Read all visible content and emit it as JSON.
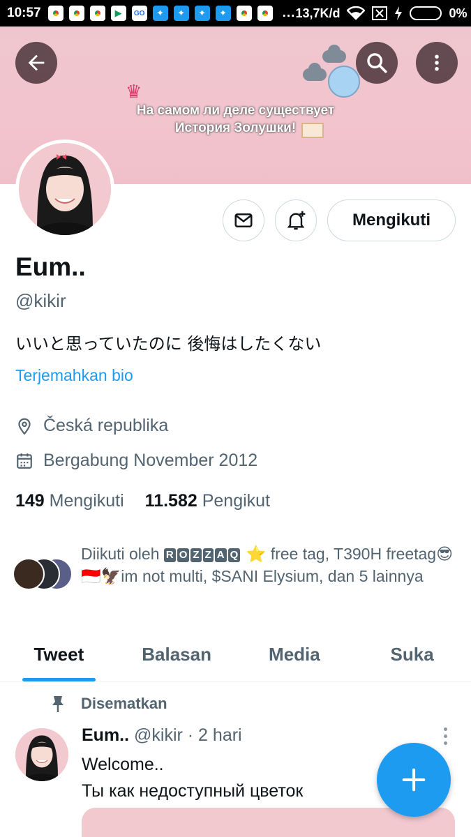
{
  "status_bar": {
    "time": "10:57",
    "network_speed": "13,7K/d",
    "battery": "0%",
    "more": "..."
  },
  "banner": {
    "line1": "На самом ли деле существует",
    "line2": "История Золушки!"
  },
  "header_buttons": {
    "back_icon": "arrow-left-icon",
    "search_icon": "search-icon",
    "more_icon": "more-vertical-icon"
  },
  "profile": {
    "name": "Eum..",
    "handle": "@kikir",
    "bio": "いいと思っていたのに 後悔はしたくない",
    "translate_label": "Terjemahkan bio",
    "location": "Česká republika",
    "joined": "Bergabung November 2012",
    "follow_button": "Mengikuti"
  },
  "counts": {
    "following_value": "149",
    "following_label": "Mengikuti",
    "followers_value": "11.582",
    "followers_label": "Pengikut"
  },
  "followed_by": {
    "prefix": "Diikuti oleh",
    "rozzaq_letters": [
      "R",
      "O",
      "Z",
      "Z",
      "A",
      "Q"
    ],
    "star": "⭐",
    "text_part1": "free tag, T390H freetag",
    "emojis": "😎🇮🇩🦅",
    "text_part2": "im not multi, $SANI Elysium, dan 5 lainnya"
  },
  "tabs": [
    {
      "label": "Tweet",
      "active": true
    },
    {
      "label": "Balasan",
      "active": false
    },
    {
      "label": "Media",
      "active": false
    },
    {
      "label": "Suka",
      "active": false
    }
  ],
  "tweet": {
    "pinned_label": "Disematkan",
    "author_name": "Eum..",
    "meta": "@kikir · 2 hari",
    "line1": "Welcome..",
    "line2": "Ты как недоступный цветок"
  },
  "colors": {
    "accent": "#1d9bf0",
    "banner": "#f2c4ce",
    "secondary_text": "#536471"
  }
}
